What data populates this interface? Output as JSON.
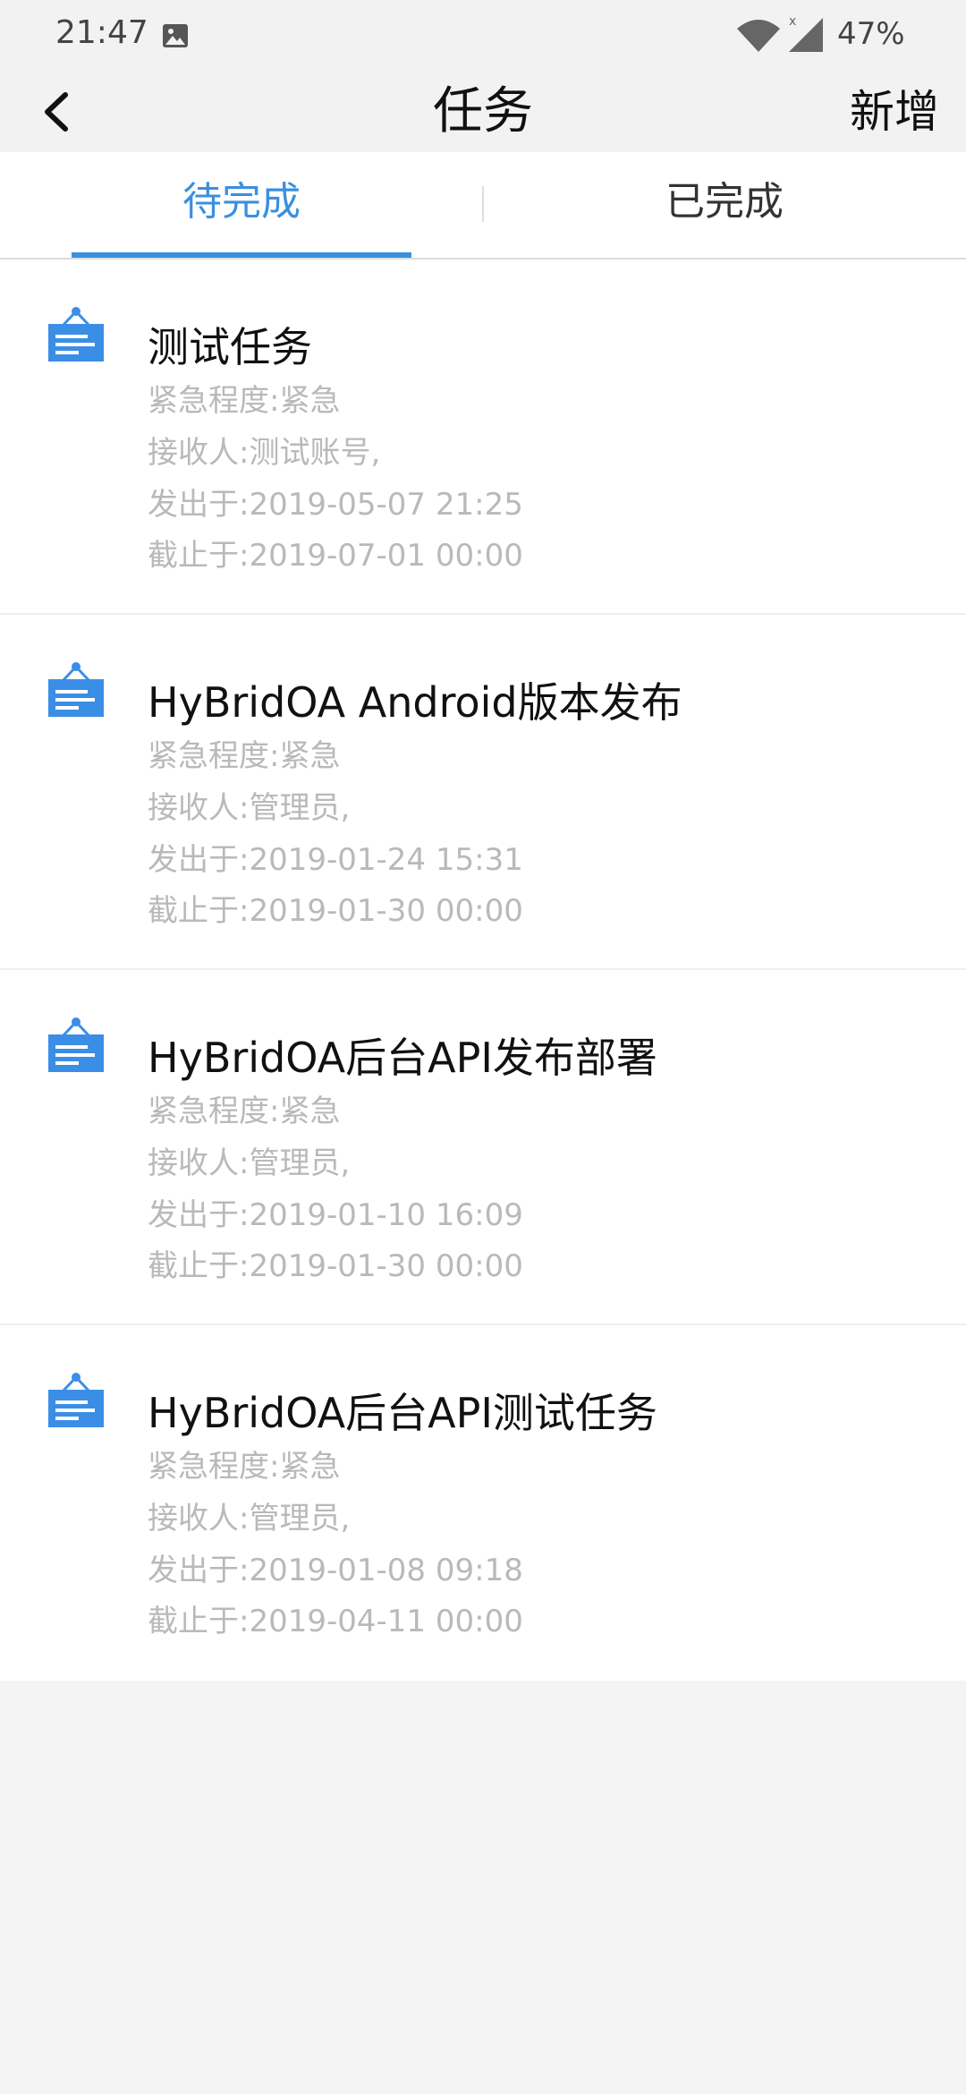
{
  "status_bar": {
    "time": "21:47",
    "battery": "47%",
    "icons": [
      "image-icon",
      "wifi-icon",
      "signal-icon"
    ]
  },
  "nav": {
    "title": "任务",
    "add_label": "新增",
    "back_icon": "chevron-left-icon"
  },
  "tabs": [
    {
      "label": "待完成",
      "active": true
    },
    {
      "label": "已完成",
      "active": false
    }
  ],
  "colors": {
    "accent": "#3b8fe0",
    "icon_blue": "#3a8ee6",
    "meta_text": "#b9b9b9"
  },
  "tasks": [
    {
      "title": "测试任务",
      "urgency": "紧急程度:紧急",
      "receiver": "接收人:测试账号,",
      "issued": "发出于:2019-05-07 21:25",
      "deadline": "截止于:2019-07-01 00:00"
    },
    {
      "title": "HyBridOA Android版本发布",
      "urgency": "紧急程度:紧急",
      "receiver": "接收人:管理员,",
      "issued": "发出于:2019-01-24 15:31",
      "deadline": "截止于:2019-01-30 00:00"
    },
    {
      "title": "HyBridOA后台API发布部署",
      "urgency": "紧急程度:紧急",
      "receiver": "接收人:管理员,",
      "issued": "发出于:2019-01-10 16:09",
      "deadline": "截止于:2019-01-30 00:00"
    },
    {
      "title": "HyBridOA后台API测试任务",
      "urgency": "紧急程度:紧急",
      "receiver": "接收人:管理员,",
      "issued": "发出于:2019-01-08 09:18",
      "deadline": "截止于:2019-04-11 00:00"
    }
  ]
}
